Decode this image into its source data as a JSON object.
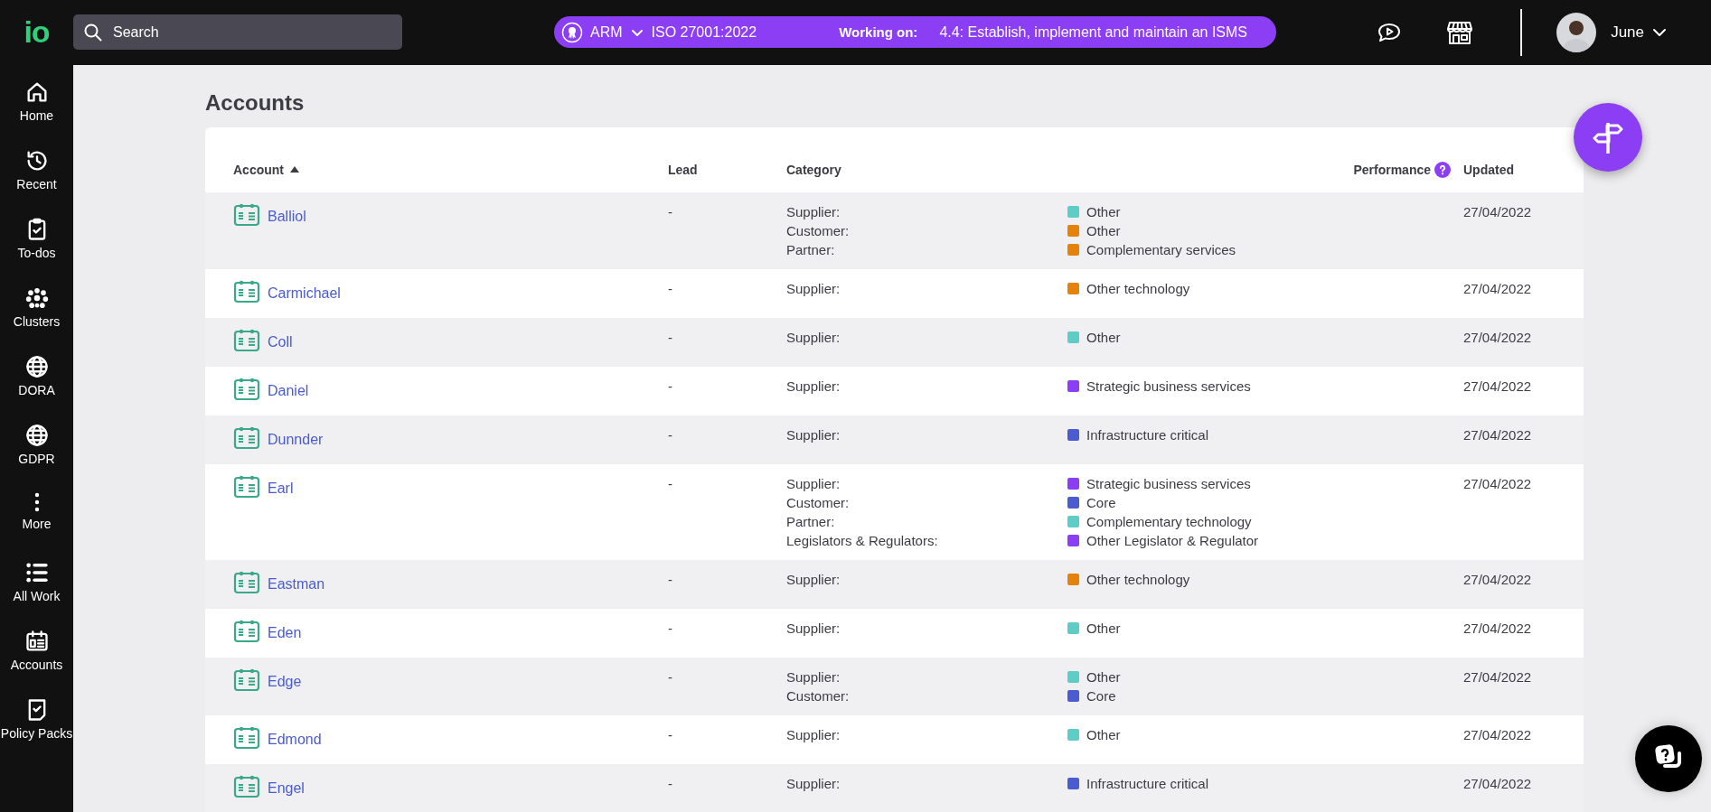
{
  "topbar": {
    "logo": "io",
    "search": {
      "placeholder": "Search"
    },
    "framework": {
      "name": "ARM",
      "standard": "ISO 27001:2022",
      "working_label": "Working on:",
      "working_task": "4.4: Establish, implement and maintain an ISMS"
    },
    "user": {
      "name": "June"
    }
  },
  "sidebar": {
    "items": [
      {
        "label": "Home"
      },
      {
        "label": "Recent"
      },
      {
        "label": "To-dos"
      },
      {
        "label": "Clusters"
      },
      {
        "label": "DORA"
      },
      {
        "label": "GDPR"
      },
      {
        "label": "More"
      },
      {
        "label": "All Work"
      },
      {
        "label": "Accounts"
      },
      {
        "label": "Policy Packs"
      }
    ]
  },
  "page": {
    "title": "Accounts"
  },
  "table": {
    "columns": [
      {
        "label": "Account",
        "sorted": true
      },
      {
        "label": "Lead",
        "sorted": false
      },
      {
        "label": "Category",
        "sorted": false
      },
      {
        "label": "Performance",
        "sorted": false
      },
      {
        "label": "Updated",
        "sorted": false
      }
    ],
    "rows": [
      {
        "account": "Balliol",
        "lead": "-",
        "updated": "27/04/2022",
        "categories": [
          {
            "role": "Supplier:",
            "value": "Other",
            "color": "#5ecdc8"
          },
          {
            "role": "Customer:",
            "value": "Other",
            "color": "#e5820c"
          },
          {
            "role": "Partner:",
            "value": "Complementary services",
            "color": "#e5820c"
          }
        ]
      },
      {
        "account": "Carmichael",
        "lead": "-",
        "updated": "27/04/2022",
        "categories": [
          {
            "role": "Supplier:",
            "value": "Other technology",
            "color": "#e5820c"
          }
        ]
      },
      {
        "account": "Coll",
        "lead": "-",
        "updated": "27/04/2022",
        "categories": [
          {
            "role": "Supplier:",
            "value": "Other",
            "color": "#5ecdc8"
          }
        ]
      },
      {
        "account": "Daniel",
        "lead": "-",
        "updated": "27/04/2022",
        "categories": [
          {
            "role": "Supplier:",
            "value": "Strategic business services",
            "color": "#8c3ef5"
          }
        ]
      },
      {
        "account": "Dunnder",
        "lead": "-",
        "updated": "27/04/2022",
        "categories": [
          {
            "role": "Supplier:",
            "value": "Infrastructure critical",
            "color": "#4b5bd0"
          }
        ]
      },
      {
        "account": "Earl",
        "lead": "-",
        "updated": "27/04/2022",
        "categories": [
          {
            "role": "Supplier:",
            "value": "Strategic business services",
            "color": "#8c3ef5"
          },
          {
            "role": "Customer:",
            "value": "Core",
            "color": "#4b5bd0"
          },
          {
            "role": "Partner:",
            "value": "Complementary technology",
            "color": "#5ecdc8"
          },
          {
            "role": "Legislators & Regulators:",
            "value": "Other Legislator & Regulator",
            "color": "#8c3ef5"
          }
        ]
      },
      {
        "account": "Eastman",
        "lead": "-",
        "updated": "27/04/2022",
        "categories": [
          {
            "role": "Supplier:",
            "value": "Other technology",
            "color": "#e5820c"
          }
        ]
      },
      {
        "account": "Eden",
        "lead": "-",
        "updated": "27/04/2022",
        "categories": [
          {
            "role": "Supplier:",
            "value": "Other",
            "color": "#5ecdc8"
          }
        ]
      },
      {
        "account": "Edge",
        "lead": "-",
        "updated": "27/04/2022",
        "categories": [
          {
            "role": "Supplier:",
            "value": "Other",
            "color": "#5ecdc8"
          },
          {
            "role": "Customer:",
            "value": "Core",
            "color": "#4b5bd0"
          }
        ]
      },
      {
        "account": "Edmond",
        "lead": "-",
        "updated": "27/04/2022",
        "categories": [
          {
            "role": "Supplier:",
            "value": "Other",
            "color": "#5ecdc8"
          }
        ]
      },
      {
        "account": "Engel",
        "lead": "-",
        "updated": "27/04/2022",
        "categories": [
          {
            "role": "Supplier:",
            "value": "Infrastructure critical",
            "color": "#4b5bd0"
          }
        ]
      }
    ]
  }
}
